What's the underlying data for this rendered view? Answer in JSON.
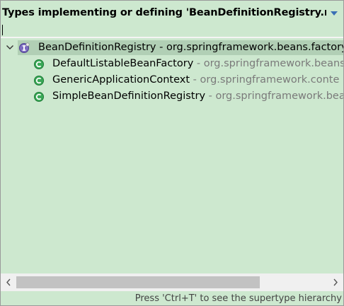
{
  "popup": {
    "title": "Types implementing or defining 'BeanDefinitionRegistry.regis",
    "filter_value": "",
    "status": "Press 'Ctrl+T' to see the supertype hierarchy"
  },
  "tree": {
    "root": {
      "name": "BeanDefinitionRegistry",
      "qualifier": " - org.springframework.beans.factory",
      "icon": "interface-icon",
      "expanded": true,
      "selected": true
    },
    "children": [
      {
        "name": "DefaultListableBeanFactory",
        "qualifier": " - org.springframework.beans",
        "icon": "class-icon"
      },
      {
        "name": "GenericApplicationContext",
        "qualifier": " - org.springframework.conte",
        "icon": "class-icon"
      },
      {
        "name": "SimpleBeanDefinitionRegistry",
        "qualifier": " - org.springframework.bea",
        "icon": "class-icon"
      }
    ]
  },
  "colors": {
    "background": "#cde8cf",
    "selection": "#b1cfb5",
    "class_icon": "#2e9d4a",
    "interface_icon": "#6a5aa8",
    "qualifier_text": "#7a7a7a"
  }
}
